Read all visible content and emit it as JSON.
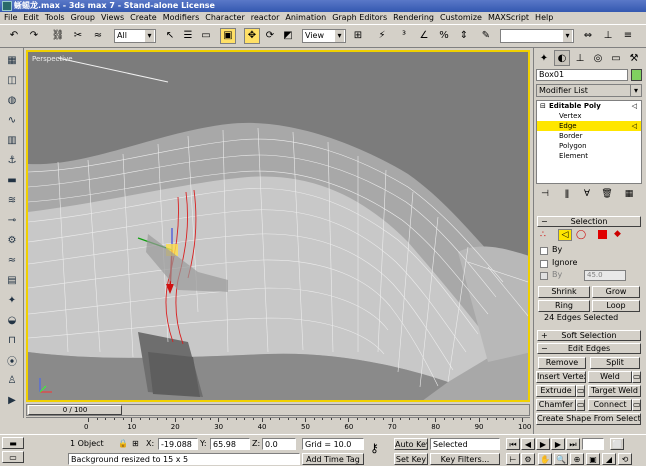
{
  "window": {
    "title": "蜥蜴龙.max - 3ds max 7 - Stand-alone License"
  },
  "menu": [
    "File",
    "Edit",
    "Tools",
    "Group",
    "Views",
    "Create",
    "Modifiers",
    "Character",
    "reactor",
    "Animation",
    "Graph Editors",
    "Rendering",
    "Customize",
    "MAXScript",
    "Help"
  ],
  "toolbar": {
    "selection_filter": "All",
    "reference_coord": "View"
  },
  "viewport": {
    "label": "Perspective"
  },
  "timeline": {
    "position": "0 / 100",
    "ticks": [
      "0",
      "10",
      "20",
      "30",
      "40",
      "50",
      "60",
      "70",
      "80",
      "90",
      "100"
    ]
  },
  "status": {
    "selection_count": "1 Object",
    "x_label": "X:",
    "x_value": "-19.088",
    "y_label": "Y:",
    "y_value": "65.98",
    "z_label": "Z:",
    "z_value": "0.0",
    "grid": "Grid = 10.0",
    "prompt": "Background resized to 15 x 5",
    "add_time_tag": "Add Time Tag",
    "auto_key": "Auto Key",
    "set_key": "Set Key",
    "key_mode": "Selected",
    "key_filters": "Key Filters..."
  },
  "command_panel": {
    "object_name": "Box01",
    "object_color": "#80d060",
    "modifier_list": "Modifier List",
    "stack": {
      "base": "Editable Poly",
      "subobjects": [
        "Vertex",
        "Edge",
        "Border",
        "Polygon",
        "Element"
      ],
      "selected_index": 1
    },
    "selection": {
      "title": "Selection",
      "by_label": "By",
      "ignore_label": "Ignore",
      "angle_label": "By",
      "angle_value": "45.0",
      "shrink": "Shrink",
      "grow": "Grow",
      "ring": "Ring",
      "loop": "Loop",
      "info": "24 Edges Selected"
    },
    "soft_selection": {
      "title": "Soft Selection"
    },
    "edit_edges": {
      "title": "Edit Edges",
      "remove": "Remove",
      "split": "Split",
      "insert_vertex": "Insert Vertex",
      "weld": "Weld",
      "extrude": "Extrude",
      "target_weld": "Target Weld",
      "chamfer": "Chamfer",
      "connect": "Connect",
      "create_shape": "Create Shape From Selection"
    }
  },
  "colors": {
    "accent_yellow": "#ffe600",
    "viewport_border": "#f0d000",
    "title_blue": "#3458b0"
  }
}
